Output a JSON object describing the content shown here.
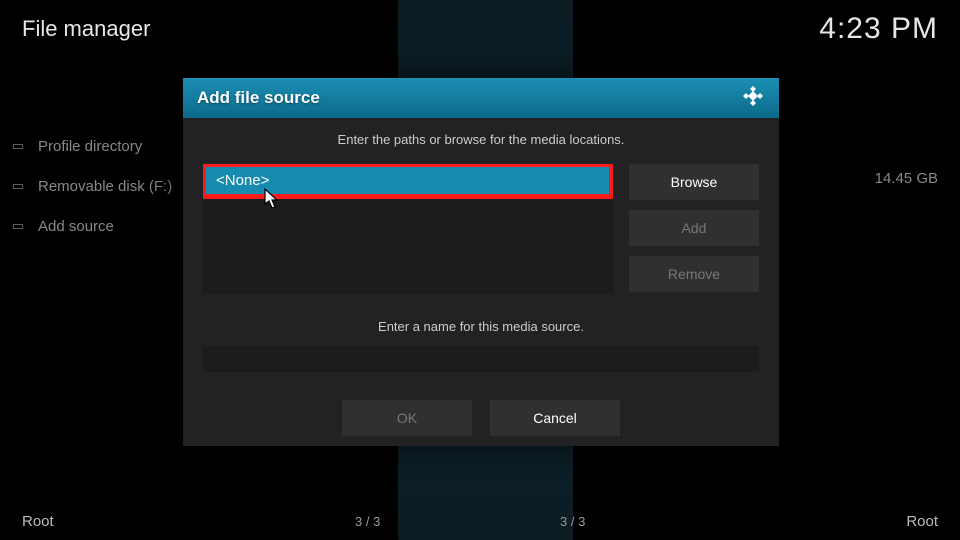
{
  "header": {
    "title": "File manager",
    "clock": "4:23 PM"
  },
  "sidebar": {
    "items": [
      {
        "icon": "folder-icon",
        "label": "Profile directory"
      },
      {
        "icon": "folder-icon",
        "label": "Removable disk (F:)",
        "meta": "14.45 GB"
      },
      {
        "icon": "folder-icon",
        "label": "Add source"
      }
    ]
  },
  "footer": {
    "left": "Root",
    "right": "Root",
    "count_left": "3 / 3",
    "count_right": "3 / 3"
  },
  "dialog": {
    "title": "Add file source",
    "instruction_paths": "Enter the paths or browse for the media locations.",
    "path_value": "<None>",
    "browse_label": "Browse",
    "add_label": "Add",
    "remove_label": "Remove",
    "instruction_name": "Enter a name for this media source.",
    "name_value": "",
    "ok_label": "OK",
    "cancel_label": "Cancel"
  },
  "colors": {
    "accent": "#178ab0",
    "highlight_border": "#ff1a1a",
    "panel": "#222225"
  }
}
